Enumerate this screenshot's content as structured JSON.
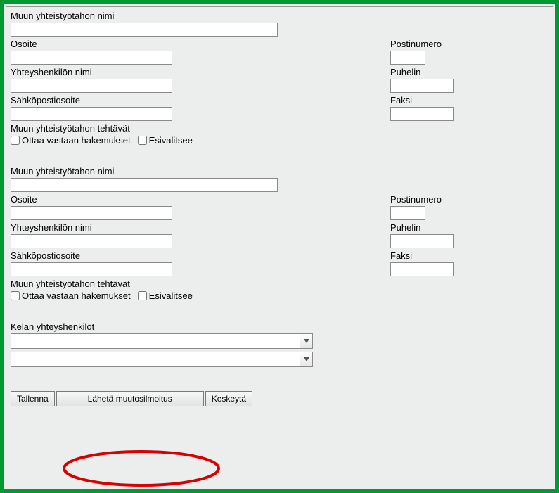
{
  "section1": {
    "name_label": "Muun yhteistyötahon nimi",
    "name_value": "",
    "address_label": "Osoite",
    "address_value": "",
    "postcode_label": "Postinumero",
    "postcode_value": "",
    "contact_label": "Yhteyshenkilön nimi",
    "contact_value": "",
    "phone_label": "Puhelin",
    "phone_value": "",
    "email_label": "Sähköpostiosoite",
    "email_value": "",
    "fax_label": "Faksi",
    "fax_value": "",
    "tasks_label": "Muun yhteistyötahon tehtävät",
    "checkbox1": "Ottaa vastaan hakemukset",
    "checkbox2": "Esivalitsee"
  },
  "section2": {
    "name_label": "Muun yhteistyötahon nimi",
    "name_value": "",
    "address_label": "Osoite",
    "address_value": "",
    "postcode_label": "Postinumero",
    "postcode_value": "",
    "contact_label": "Yhteyshenkilön nimi",
    "contact_value": "",
    "phone_label": "Puhelin",
    "phone_value": "",
    "email_label": "Sähköpostiosoite",
    "email_value": "",
    "fax_label": "Faksi",
    "fax_value": "",
    "tasks_label": "Muun yhteistyötahon tehtävät",
    "checkbox1": "Ottaa vastaan hakemukset",
    "checkbox2": "Esivalitsee"
  },
  "kela": {
    "label": "Kelan yhteyshenkilöt",
    "select1": "",
    "select2": ""
  },
  "buttons": {
    "save": "Tallenna",
    "send": "Lähetä muutosilmoitus",
    "cancel": "Keskeytä"
  }
}
